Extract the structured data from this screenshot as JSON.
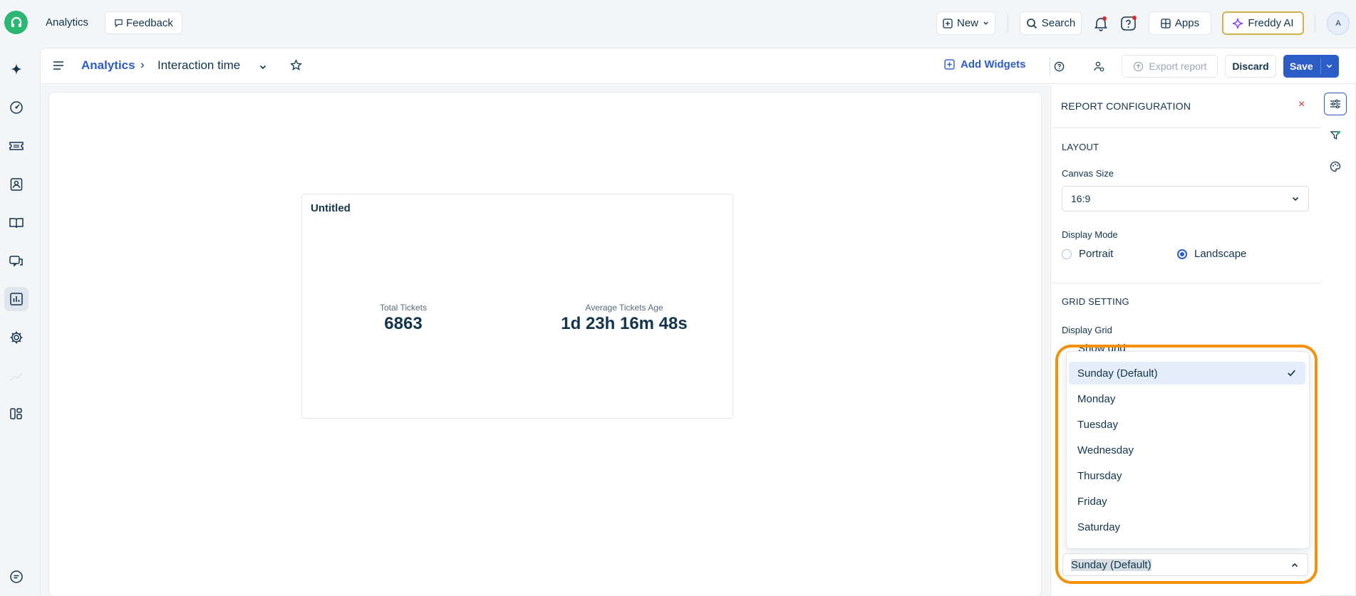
{
  "topbar": {
    "app_name": "Analytics",
    "feedback_label": "Feedback",
    "new_label": "New",
    "search_label": "Search",
    "apps_label": "Apps",
    "freddy_label": "Freddy AI",
    "avatar_initial": "A"
  },
  "breadcrumb": {
    "root": "Analytics",
    "separator": "›",
    "title": "Interaction time"
  },
  "toolbar": {
    "add_widgets": "Add Widgets",
    "export_report": "Export report",
    "discard": "Discard",
    "save": "Save"
  },
  "widget": {
    "title": "Untitled",
    "metrics": [
      {
        "label": "Total Tickets",
        "value": "6863"
      },
      {
        "label": "Average Tickets Age",
        "value": "1d 23h 16m 48s"
      }
    ]
  },
  "config": {
    "title": "REPORT CONFIGURATION",
    "close": "×",
    "layout_section": "LAYOUT",
    "canvas_size_label": "Canvas Size",
    "canvas_size_value": "16:9",
    "display_mode_label": "Display Mode",
    "portrait_label": "Portrait",
    "landscape_label": "Landscape",
    "display_mode_selected": "Landscape",
    "grid_section": "GRID SETTING",
    "display_grid_label": "Display Grid",
    "show_grid_label": "Show grid"
  },
  "week_start": {
    "selected": "Sunday (Default)",
    "options": [
      "Sunday (Default)",
      "Monday",
      "Tuesday",
      "Wednesday",
      "Thursday",
      "Friday",
      "Saturday"
    ]
  },
  "colors": {
    "primary": "#2c5cc5",
    "highlight": "#f5900b",
    "brand_green": "#2bb673"
  }
}
